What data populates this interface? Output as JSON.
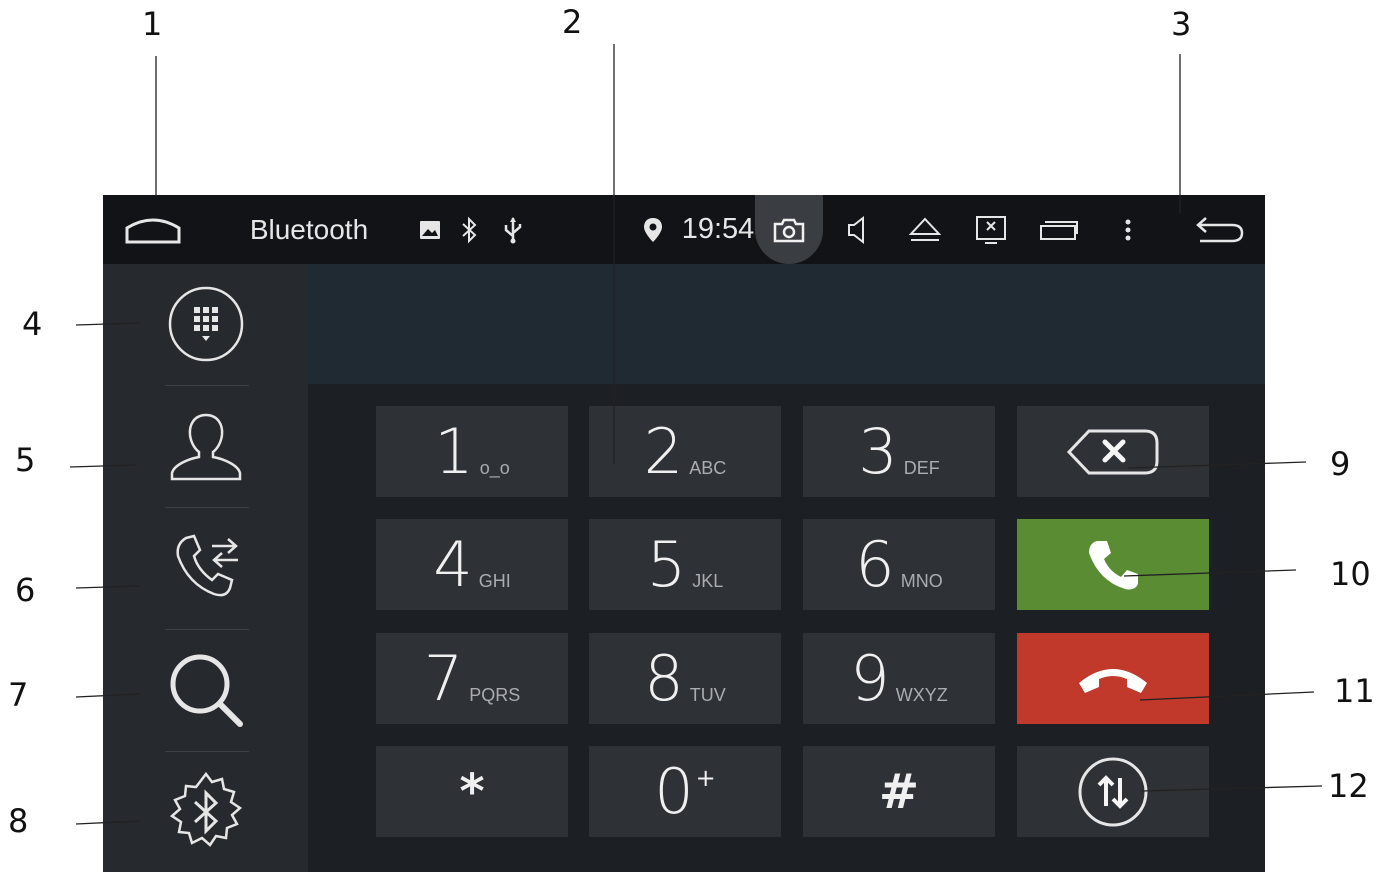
{
  "callouts": [
    "1",
    "2",
    "3",
    "4",
    "5",
    "6",
    "7",
    "8",
    "9",
    "10",
    "11",
    "12"
  ],
  "statusbar": {
    "title": "Bluetooth",
    "time": "19:54",
    "icons": [
      "home-icon",
      "gallery-icon",
      "bluetooth-icon",
      "usb-icon",
      "location-icon",
      "camera-icon",
      "volume-icon",
      "eject-icon",
      "screen-off-icon",
      "recent-apps-icon",
      "more-icon",
      "back-icon"
    ]
  },
  "sidebar": {
    "items": [
      "dialpad-icon",
      "contacts-icon",
      "call-log-icon",
      "search-icon",
      "bluetooth-settings-icon"
    ]
  },
  "display": {
    "number": ""
  },
  "keypad": {
    "keys": [
      {
        "digit": "1",
        "letters": "o_o"
      },
      {
        "digit": "2",
        "letters": "ABC"
      },
      {
        "digit": "3",
        "letters": "DEF"
      },
      {
        "digit": "4",
        "letters": "GHI"
      },
      {
        "digit": "5",
        "letters": "JKL"
      },
      {
        "digit": "6",
        "letters": "MNO"
      },
      {
        "digit": "7",
        "letters": "PQRS"
      },
      {
        "digit": "8",
        "letters": "TUV"
      },
      {
        "digit": "9",
        "letters": "WXYZ"
      },
      {
        "digit": "*",
        "letters": ""
      },
      {
        "digit": "0",
        "letters": "+"
      },
      {
        "digit": "#",
        "letters": ""
      }
    ],
    "actions": [
      "backspace-icon",
      "call-icon",
      "hang-up-icon",
      "switch-audio-icon"
    ]
  },
  "colors": {
    "call": "#5a8c34",
    "hang_up": "#c0392b",
    "key_bg": "#2e3136",
    "sidebar_bg": "#26292e",
    "statusbar_bg": "#111316"
  }
}
